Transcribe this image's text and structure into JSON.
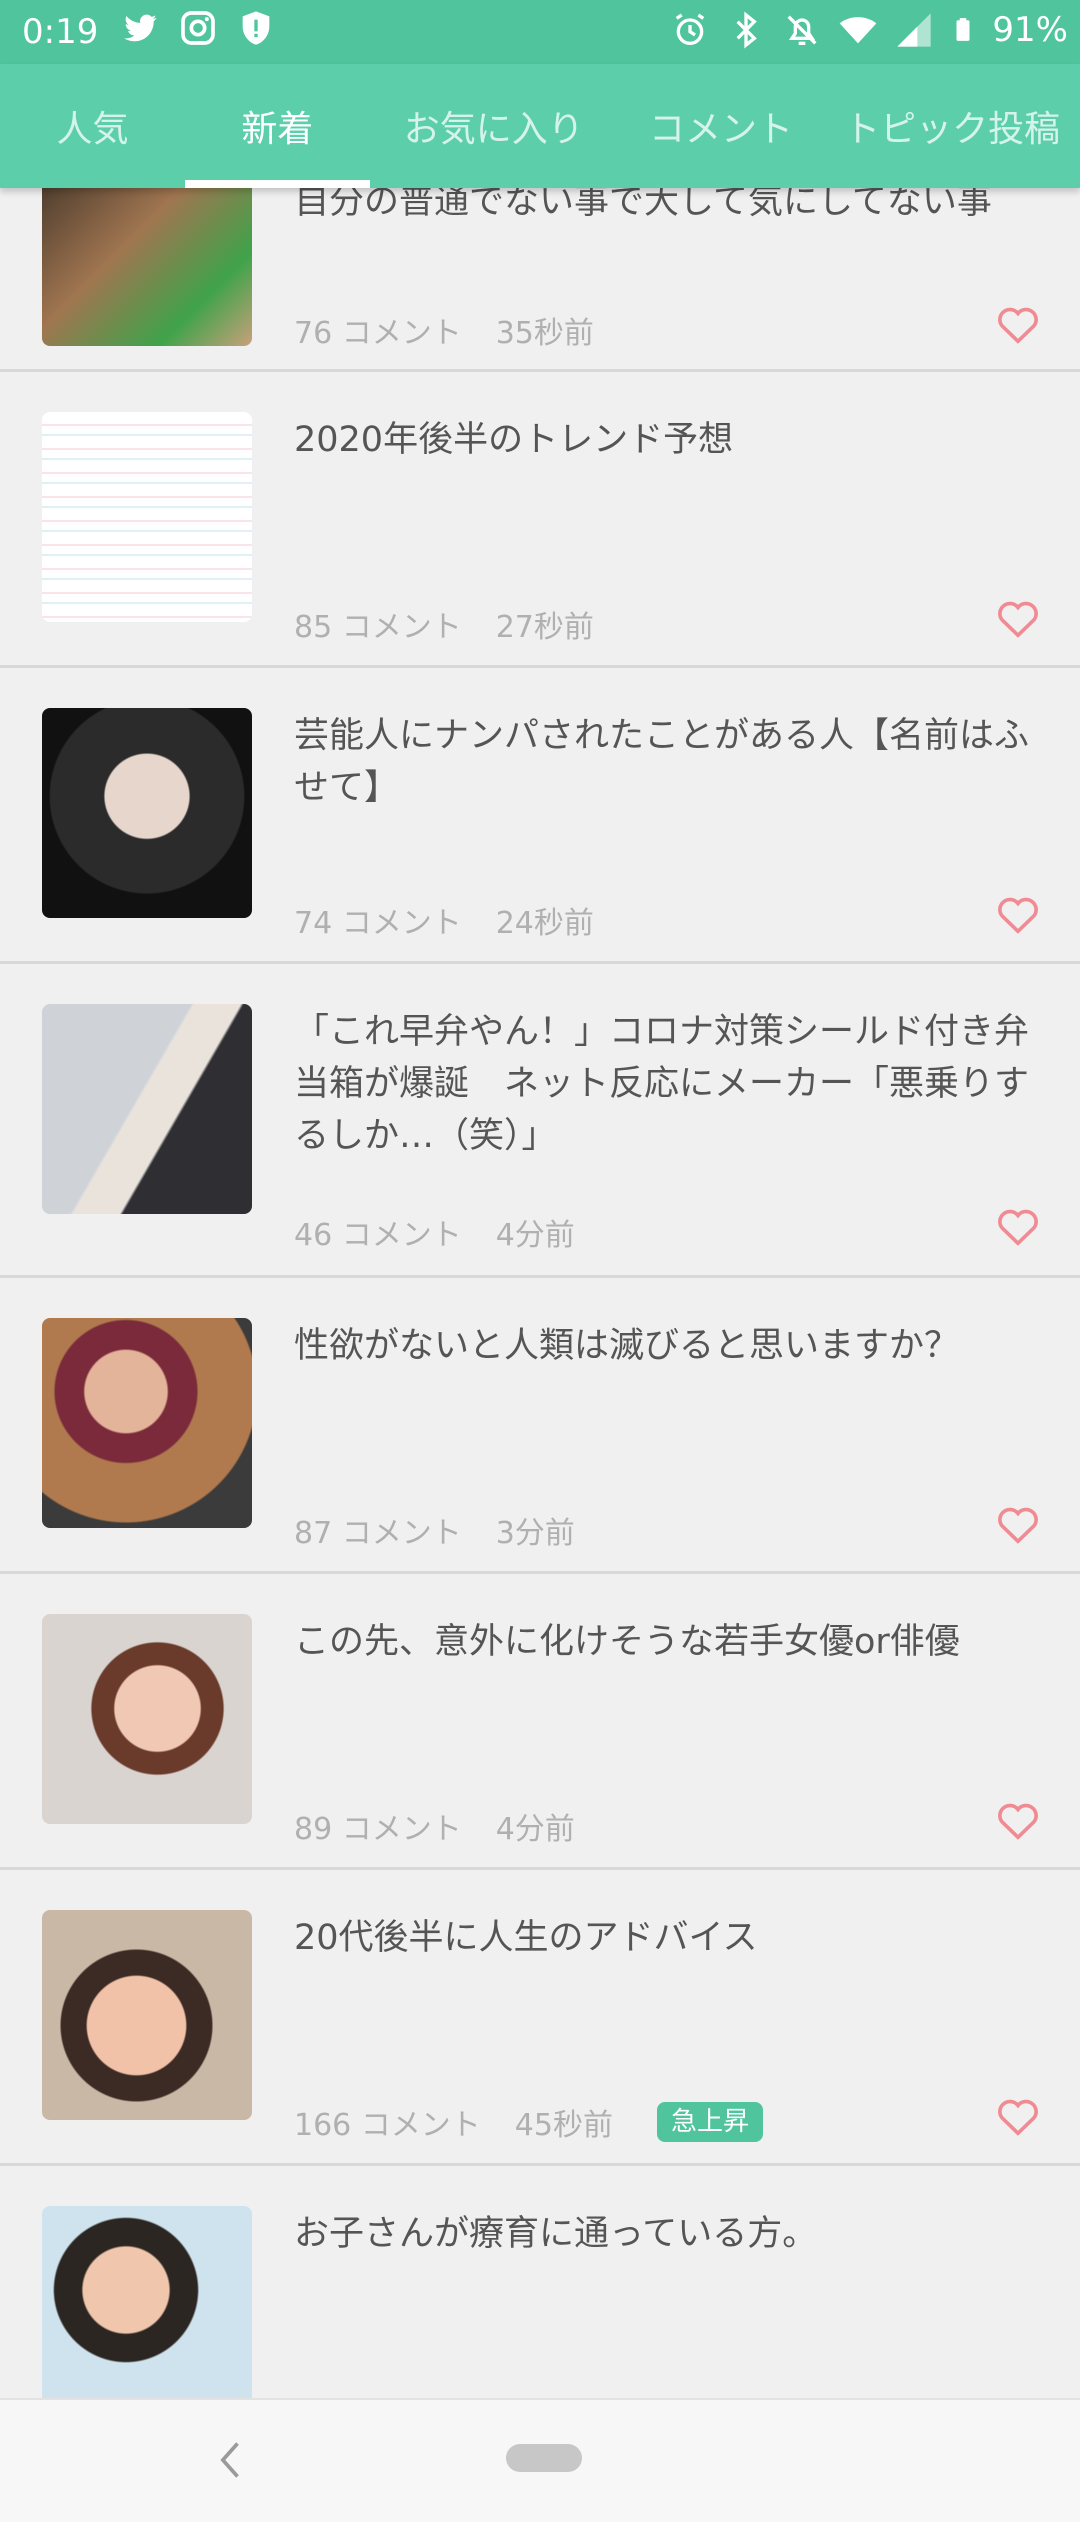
{
  "status": {
    "time": "0:19",
    "battery": "91%",
    "left_icons": [
      "twitter-icon",
      "instagram-icon",
      "shield-alert-icon"
    ],
    "right_icons": [
      "alarm-icon",
      "bluetooth-icon",
      "mute-bell-icon",
      "wifi-icon",
      "signal-icon",
      "battery-icon"
    ]
  },
  "tabs": [
    {
      "label": "人気",
      "active": false
    },
    {
      "label": "新着",
      "active": true
    },
    {
      "label": "お気に入り",
      "active": false
    },
    {
      "label": "コメント",
      "active": false
    },
    {
      "label": "トピック投稿",
      "active": false
    }
  ],
  "topics": [
    {
      "title": "自分の普通でない事で大して気にしてない事",
      "comments": "76 コメント",
      "time": "35秒前",
      "badge": ""
    },
    {
      "title": "2020年後半のトレンド予想",
      "comments": "85 コメント",
      "time": "27秒前",
      "badge": ""
    },
    {
      "title": "芸能人にナンパされたことがある人【名前はふせて】",
      "comments": "74 コメント",
      "time": "24秒前",
      "badge": ""
    },
    {
      "title": "「これ早弁やん！」コロナ対策シールド付き弁当箱が爆誕　ネット反応にメーカー「悪乗りするしか…（笑）」",
      "comments": "46 コメント",
      "time": "4分前",
      "badge": ""
    },
    {
      "title": "性欲がないと人類は滅びると思いますか？",
      "comments": "87 コメント",
      "time": "3分前",
      "badge": ""
    },
    {
      "title": "この先、意外に化けそうな若手女優or俳優",
      "comments": "89 コメント",
      "time": "4分前",
      "badge": ""
    },
    {
      "title": "20代後半に人生のアドバイス",
      "comments": "166 コメント",
      "time": "45秒前",
      "badge": "急上昇"
    },
    {
      "title": "お子さんが療育に通っている方。",
      "comments": "",
      "time": "",
      "badge": ""
    }
  ],
  "colors": {
    "brand": "#5ccfaa",
    "status_bar": "#4fc49d",
    "heart": "#f08a93",
    "badge": "#4fc49d"
  },
  "nav": {
    "back_icon": "back-chevron-icon",
    "home_icon": "home-pill-icon"
  }
}
